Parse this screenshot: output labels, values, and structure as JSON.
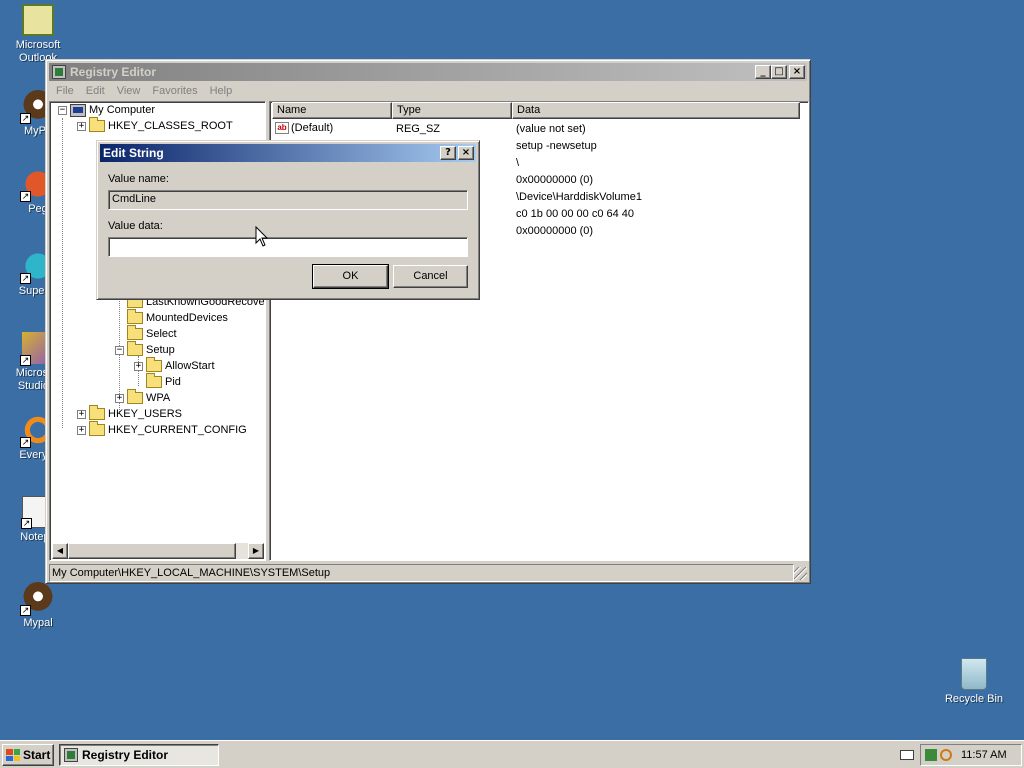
{
  "desktop": {
    "icons": [
      {
        "label": "Microsoft Outlook",
        "icon": "outlook-icon"
      },
      {
        "label": "MyPa",
        "icon": "mypal-icon"
      },
      {
        "label": "Peg",
        "icon": "pegasus-icon"
      },
      {
        "label": "Superm",
        "icon": "supermium-icon"
      },
      {
        "label": "Microsoft Studio 2",
        "icon": "studio-icon"
      },
      {
        "label": "Everyth",
        "icon": "everything-icon"
      },
      {
        "label": "Notepa",
        "icon": "notepad-icon"
      },
      {
        "label": "Mypal",
        "icon": "mypal-icon"
      },
      {
        "label": "Recycle Bin",
        "icon": "recycle-bin-icon"
      }
    ]
  },
  "regedit": {
    "title": "Registry Editor",
    "menu": [
      "File",
      "Edit",
      "View",
      "Favorites",
      "Help"
    ],
    "tree": {
      "root": "My Computer",
      "items": [
        {
          "label": "HKEY_CLASSES_ROOT"
        },
        {
          "label": "LastKnownGoodRecove"
        },
        {
          "label": "MountedDevices"
        },
        {
          "label": "Select"
        },
        {
          "label": "Setup"
        },
        {
          "label": "AllowStart"
        },
        {
          "label": "Pid"
        },
        {
          "label": "WPA"
        },
        {
          "label": "HKEY_USERS"
        },
        {
          "label": "HKEY_CURRENT_CONFIG"
        }
      ]
    },
    "list": {
      "columns": [
        "Name",
        "Type",
        "Data"
      ],
      "rows": [
        {
          "name": "(Default)",
          "type": "REG_SZ",
          "data": "(value not set)"
        },
        {
          "name": "",
          "type": "",
          "data": "setup -newsetup"
        },
        {
          "name": "",
          "type": "",
          "data": "\\"
        },
        {
          "name": "",
          "type": "",
          "data": "0x00000000 (0)"
        },
        {
          "name": "",
          "type": "",
          "data": "\\Device\\HarddiskVolume1"
        },
        {
          "name": "",
          "type": "",
          "data": "c0 1b 00 00 00 c0 64 40"
        },
        {
          "name": "",
          "type": "",
          "data": "0x00000000 (0)"
        }
      ]
    },
    "status": "My Computer\\HKEY_LOCAL_MACHINE\\SYSTEM\\Setup"
  },
  "dialog": {
    "title": "Edit String",
    "value_name_label": "Value name:",
    "value_name": "CmdLine",
    "value_data_label": "Value data:",
    "value_data": "",
    "ok": "OK",
    "cancel": "Cancel"
  },
  "taskbar": {
    "start": "Start",
    "task": "Registry Editor",
    "clock": "11:57 AM"
  }
}
